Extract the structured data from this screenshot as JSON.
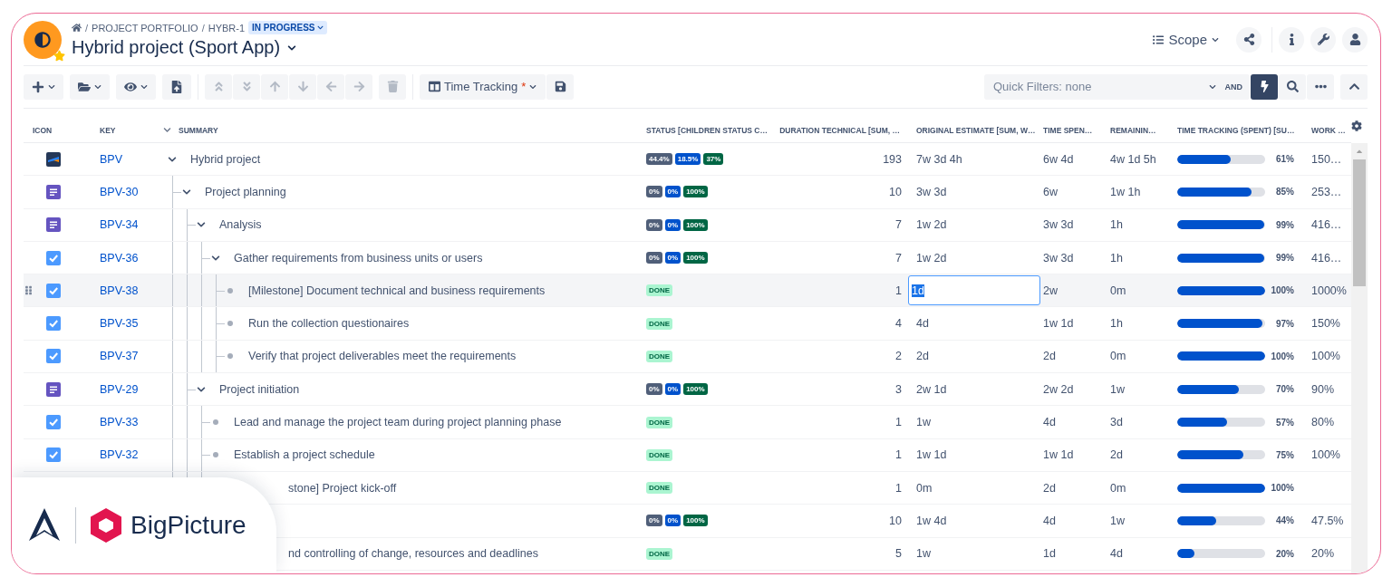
{
  "header": {
    "separator": "/",
    "breadcrumb": [
      "PROJECT PORTFOLIO",
      "HYBR-1"
    ],
    "status": "IN PROGRESS",
    "title": "Hybrid project (Sport App)",
    "scope": "Scope"
  },
  "toolbar": {
    "buttons": [
      {
        "disabled": false
      },
      {
        "disabled": false
      },
      {
        "disabled": false
      },
      {
        "disabled": false
      },
      {
        "disabled": true
      },
      {
        "disabled": true
      },
      {
        "disabled": true
      },
      {
        "disabled": true
      },
      {
        "disabled": true
      },
      {
        "disabled": true
      },
      {
        "disabled": true
      }
    ],
    "view": {
      "label": "Time Tracking",
      "unsaved": "*"
    },
    "quick_filters": {
      "placeholder": "Quick Filters: none",
      "operator": "AND"
    },
    "tools": [
      {
        "selected": true
      },
      {
        "selected": false
      },
      {
        "selected": false
      }
    ]
  },
  "table": {
    "columns": [
      "ICON",
      "KEY",
      "SUMMARY",
      "STATUS [CHILDREN STATUS C…",
      "DURATION TECHNICAL [SUM, …",
      "ORIGINAL ESTIMATE [SUM, W…",
      "TIME SPEN…",
      "REMAININ…",
      "TIME TRACKING (SPENT) [SU…",
      "WORK …"
    ],
    "rows": [
      {
        "kind": "project",
        "key": "BPV",
        "summary": "Hybrid project",
        "status": [
          {
            "label": "44.4%",
            "color": "#505f79"
          },
          {
            "label": "18.5%",
            "color": "#0052cc"
          },
          {
            "label": "37%",
            "color": "#006644"
          }
        ],
        "duration": "193",
        "estimate": "7w 3d 4h",
        "spent": "6w 4d",
        "remaining": "4w 1d 5h",
        "level": 0.61,
        "percent": "61%",
        "work": "150…",
        "selected": false,
        "expanded": true,
        "children": [
          {
            "kind": "story",
            "key": "BPV-30",
            "summary": "Project planning",
            "status": [
              {
                "label": "0%",
                "color": "#505f79"
              },
              {
                "label": "0%",
                "color": "#0052cc"
              },
              {
                "label": "100%",
                "color": "#006644"
              }
            ],
            "duration": "10",
            "estimate": "3w 3d",
            "spent": "6w",
            "remaining": "1w 1h",
            "level": 0.85,
            "percent": "85%",
            "work": "253…",
            "selected": false,
            "expanded": true,
            "children": [
              {
                "kind": "story",
                "key": "BPV-34",
                "summary": "Analysis",
                "status": [
                  {
                    "label": "0%",
                    "color": "#505f79"
                  },
                  {
                    "label": "0%",
                    "color": "#0052cc"
                  },
                  {
                    "label": "100%",
                    "color": "#006644"
                  }
                ],
                "duration": "7",
                "estimate": "1w 2d",
                "spent": "3w 3d",
                "remaining": "1h",
                "level": 0.99,
                "percent": "99%",
                "work": "416…",
                "selected": false,
                "expanded": true,
                "children": [
                  {
                    "kind": "task",
                    "key": "BPV-36",
                    "summary": "Gather requirements from business units or users",
                    "status": [
                      {
                        "label": "0%",
                        "color": "#505f79"
                      },
                      {
                        "label": "0%",
                        "color": "#0052cc"
                      },
                      {
                        "label": "100%",
                        "color": "#006644"
                      }
                    ],
                    "duration": "7",
                    "estimate": "1w 2d",
                    "spent": "3w 3d",
                    "remaining": "1h",
                    "level": 0.99,
                    "percent": "99%",
                    "work": "416…",
                    "selected": false,
                    "expanded": true,
                    "children": [
                      {
                        "kind": "task",
                        "key": "BPV-38",
                        "summary": "[Milestone] Document technical and business requirements",
                        "status": [
                          {
                            "label": "DONE",
                            "color": "#abf5d1"
                          }
                        ],
                        "duration": "1",
                        "estimate": "1d",
                        "editing": true,
                        "spent": "2w",
                        "remaining": "0m",
                        "level": 1,
                        "percent": "100%",
                        "work": "1000%",
                        "selected": true
                      },
                      {
                        "kind": "task",
                        "key": "BPV-35",
                        "summary": "Run the collection questionaires",
                        "status": [
                          {
                            "label": "DONE",
                            "color": "#abf5d1"
                          }
                        ],
                        "duration": "4",
                        "estimate": "4d",
                        "spent": "1w 1d",
                        "remaining": "1h",
                        "level": 0.97,
                        "percent": "97%",
                        "work": "150%",
                        "selected": false
                      },
                      {
                        "kind": "task",
                        "key": "BPV-37",
                        "summary": "Verify that project deliverables meet the requirements",
                        "status": [
                          {
                            "label": "DONE",
                            "color": "#abf5d1"
                          }
                        ],
                        "duration": "2",
                        "estimate": "2d",
                        "spent": "2d",
                        "remaining": "0m",
                        "level": 1,
                        "percent": "100%",
                        "work": "100%",
                        "selected": false
                      }
                    ]
                  }
                ]
              },
              {
                "kind": "story",
                "key": "BPV-29",
                "summary": "Project initiation",
                "status": [
                  {
                    "label": "0%",
                    "color": "#505f79"
                  },
                  {
                    "label": "0%",
                    "color": "#0052cc"
                  },
                  {
                    "label": "100%",
                    "color": "#006644"
                  }
                ],
                "duration": "3",
                "estimate": "2w 1d",
                "spent": "2w 2d",
                "remaining": "1w",
                "level": 0.7,
                "percent": "70%",
                "work": "90%",
                "selected": false,
                "expanded": true,
                "children": [
                  {
                    "kind": "task",
                    "key": "BPV-33",
                    "summary": "Lead and manage the project team during project planning phase",
                    "status": [
                      {
                        "label": "DONE",
                        "color": "#abf5d1"
                      }
                    ],
                    "duration": "1",
                    "estimate": "1w",
                    "spent": "4d",
                    "remaining": "3d",
                    "level": 0.57,
                    "percent": "57%",
                    "work": "80%",
                    "selected": false
                  },
                  {
                    "kind": "task",
                    "key": "BPV-32",
                    "summary": "Establish a project schedule",
                    "status": [
                      {
                        "label": "DONE",
                        "color": "#abf5d1"
                      }
                    ],
                    "duration": "1",
                    "estimate": "1w 1d",
                    "spent": "1w 1d",
                    "remaining": "2d",
                    "level": 0.75,
                    "percent": "75%",
                    "work": "100%",
                    "selected": false
                  },
                  {
                    "summary": "stone] Project kick-off",
                    "status": [
                      {
                        "label": "DONE",
                        "color": "#abf5d1"
                      }
                    ],
                    "duration": "1",
                    "estimate": "0m",
                    "spent": "2d",
                    "remaining": "0m",
                    "level": 1,
                    "percent": "100%"
                  }
                ]
              }
            ]
          },
          {
            "status": [
              {
                "label": "0%",
                "color": "#505f79"
              },
              {
                "label": "0%",
                "color": "#0052cc"
              },
              {
                "label": "100%",
                "color": "#006644"
              }
            ],
            "duration": "10",
            "estimate": "1w 4d",
            "spent": "4d",
            "remaining": "1w",
            "level": 0.44,
            "percent": "44%",
            "work": "47.5%",
            "children": [
              {
                "summary": "nd controlling of change, resources and deadlines",
                "status": [
                  {
                    "label": "DONE",
                    "color": "#abf5d1"
                  }
                ],
                "duration": "5",
                "estimate": "1w",
                "spent": "1d",
                "remaining": "4d",
                "level": 0.2,
                "percent": "20%",
                "work": "20%"
              }
            ]
          }
        ]
      }
    ]
  },
  "brand_badge": {
    "name": "BigPicture"
  }
}
